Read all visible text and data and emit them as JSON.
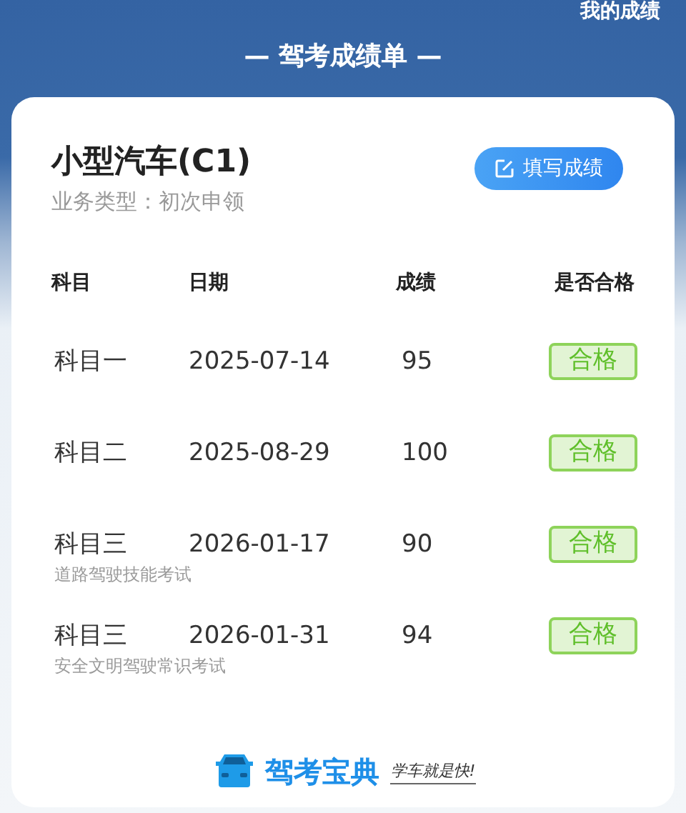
{
  "top_link": "我的成绩",
  "title": "— 驾考成绩单 —",
  "card": {
    "license": "小型汽车(C1)",
    "business_type": "业务类型：初次申领",
    "fill_button": "填写成绩"
  },
  "table": {
    "columns": [
      "科目",
      "日期",
      "成绩",
      "是否合格"
    ],
    "rows": [
      {
        "subject": "科目一",
        "date": "2025-07-14",
        "score": "95",
        "result": "合格",
        "passed": true
      },
      {
        "subject": "科目二",
        "date": "2025-08-29",
        "score": "100",
        "result": "合格",
        "passed": true
      },
      {
        "subject": "科目三",
        "date": "2026-01-17",
        "score": "90",
        "note": "道路驾驶技能考试",
        "result": "合格",
        "passed": true
      },
      {
        "subject": "科目三",
        "date": "2026-01-31",
        "score": "94",
        "note": "安全文明驾驶常识考试",
        "result": "合格",
        "passed": true
      }
    ]
  },
  "footer": {
    "brand": "驾考宝典",
    "slogan": "学车就是快!"
  }
}
